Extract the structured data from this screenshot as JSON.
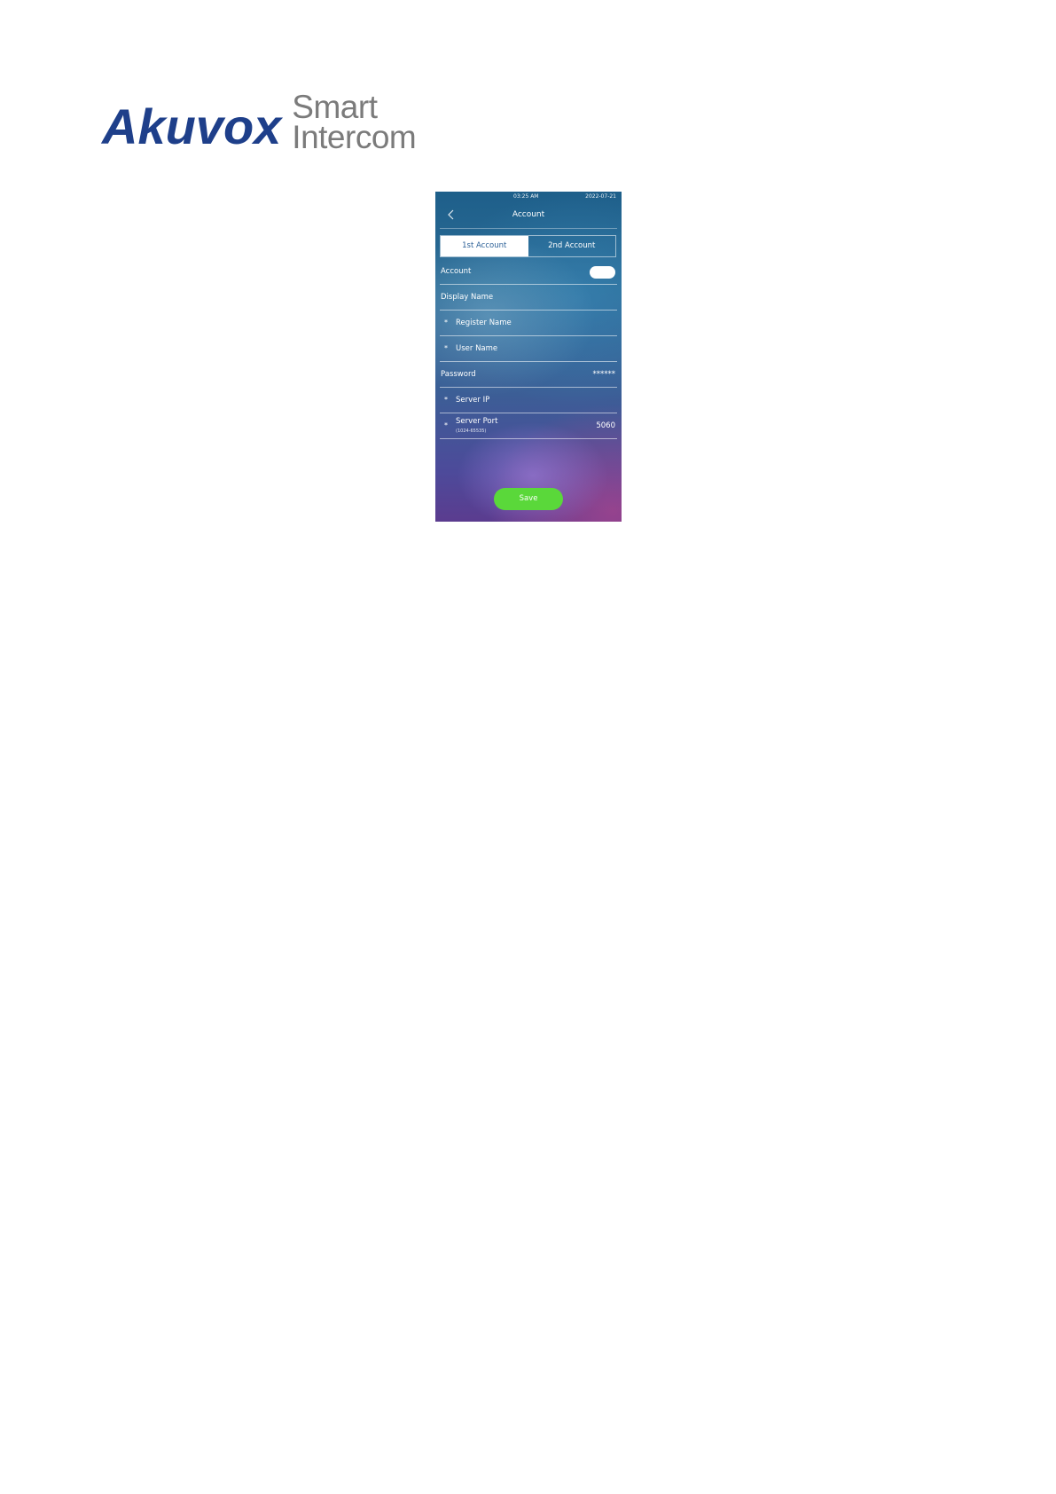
{
  "logo": {
    "brand": "Akuvox",
    "tagline_line1": "Smart",
    "tagline_line2": "Intercom"
  },
  "screen": {
    "status": {
      "time": "03:25  AM",
      "date": "2022-07-21"
    },
    "title": "Account",
    "tabs": [
      {
        "label": "1st Account",
        "active": true
      },
      {
        "label": "2nd Account",
        "active": false
      }
    ],
    "rows": {
      "account": {
        "label": "Account",
        "toggle_on": true
      },
      "display_name": {
        "label": "Display Name"
      },
      "register_name": {
        "label": "Register Name",
        "required_mark": "*"
      },
      "user_name": {
        "label": "User Name",
        "required_mark": "*"
      },
      "password": {
        "label": "Password",
        "value": "******"
      },
      "server_ip": {
        "label": "Server IP",
        "required_mark": "*"
      },
      "server_port": {
        "label": "Server Port",
        "hint": "(1024-65535)",
        "value": "5060",
        "required_mark": "*"
      }
    },
    "save_label": "Save",
    "colors": {
      "brand_blue": "#1e3f8a",
      "tagline_gray": "#7b7b7b",
      "save_green": "#5ad83a",
      "active_tab_text": "#2a5f96"
    }
  }
}
